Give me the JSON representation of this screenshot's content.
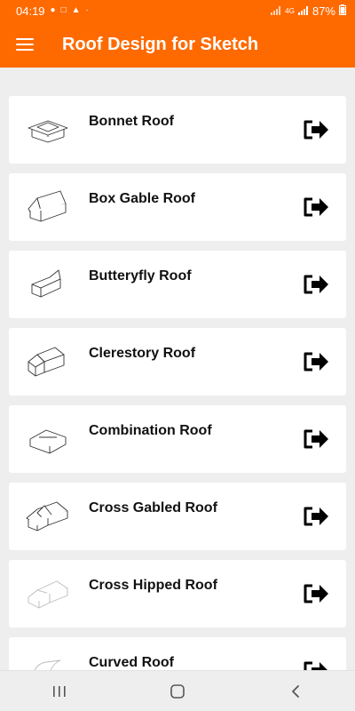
{
  "status_bar": {
    "time": "04:19",
    "battery": "87%",
    "network": "4G",
    "icons": [
      "notification-icon",
      "lock-icon",
      "warning-icon",
      "dot-icon",
      "signal-icon",
      "network-icon",
      "battery-icon"
    ]
  },
  "app_bar": {
    "title": "Roof Design for Sketch",
    "menu_icon": "hamburger-menu-icon"
  },
  "roofs": [
    {
      "label": "Bonnet Roof",
      "icon": "bonnet-roof-icon"
    },
    {
      "label": "Box Gable Roof",
      "icon": "box-gable-roof-icon"
    },
    {
      "label": "Butteryfly Roof",
      "icon": "butterfly-roof-icon"
    },
    {
      "label": "Clerestory Roof",
      "icon": "clerestory-roof-icon"
    },
    {
      "label": "Combination Roof",
      "icon": "combination-roof-icon"
    },
    {
      "label": "Cross Gabled Roof",
      "icon": "cross-gabled-roof-icon"
    },
    {
      "label": "Cross Hipped Roof",
      "icon": "cross-hipped-roof-icon"
    },
    {
      "label": "Curved Roof",
      "icon": "curved-roof-icon"
    }
  ],
  "nav_bar": {
    "icons": [
      "recent-apps-icon",
      "home-icon",
      "back-icon"
    ]
  },
  "colors": {
    "accent": "#ff6a00",
    "background": "#eeeeee",
    "card": "#ffffff"
  }
}
